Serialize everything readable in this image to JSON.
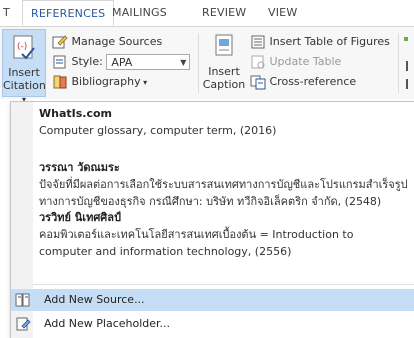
{
  "tabs": {
    "partial_left": "T",
    "references": "REFERENCES",
    "mailings": "MAILINGS",
    "review": "REVIEW",
    "view": "VIEW"
  },
  "ribbon": {
    "insert_citation_line1": "Insert",
    "insert_citation_line2": "Citation",
    "manage_sources": "Manage Sources",
    "style_label": "Style:",
    "style_value": "APA",
    "bibliography": "Bibliography",
    "insert_caption_line1": "Insert",
    "insert_caption_line2": "Caption",
    "insert_table_of_figures": "Insert Table of Figures",
    "update_table": "Update Table",
    "cross_reference": "Cross-reference"
  },
  "dropdown": {
    "sources": [
      {
        "author": "WhatIs.com",
        "details": [
          "Computer glossary, computer term, (2016)"
        ]
      },
      {
        "author": "วรรณา วัดณมระ",
        "details": [
          "ปัจจัยที่มีผลต่อการเลือกใช้ระบบสารสนเทศทางการบัญชีและโปรแกรมสำเร็จรูป",
          "ทางการบัญชีของธุรกิจ กรณีศึกษา: บริษัท ทวีกิจอิเล็คตริก จำกัด, (2548)"
        ]
      },
      {
        "author": "วรวิทย์ นิเทศศิลป์",
        "details": [
          "คอมพิวเตอร์และเทคโนโลยีสารสนเทศเบื้องต้น = Introduction to",
          "computer and information technology, (2556)"
        ]
      }
    ],
    "add_new_source": "Add New Source...",
    "add_new_placeholder": "Add New Placeholder..."
  },
  "colors": {
    "accent": "#2b579a",
    "hover": "#c5def5"
  }
}
